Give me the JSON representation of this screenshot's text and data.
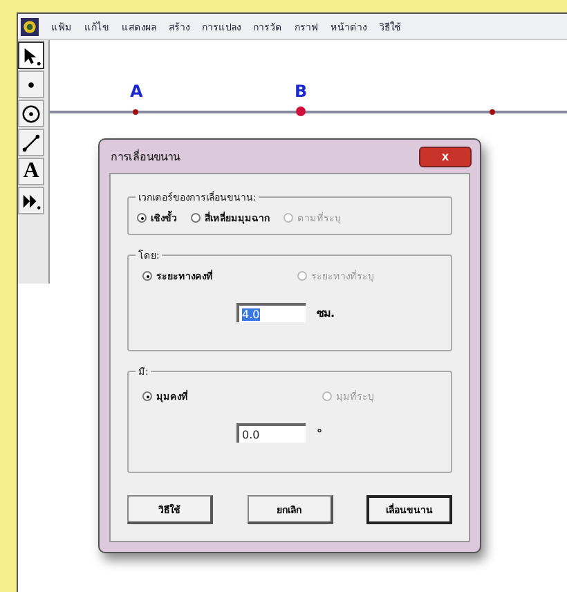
{
  "menu": [
    {
      "label": "แฟ้ม"
    },
    {
      "label": "แก้ไข"
    },
    {
      "label": "แสดงผล"
    },
    {
      "label": "สร้าง"
    },
    {
      "label": "การแปลง"
    },
    {
      "label": "การวัด"
    },
    {
      "label": "กราฟ"
    },
    {
      "label": "หน้าต่าง"
    },
    {
      "label": "วิธีใช้"
    }
  ],
  "tools": [
    {
      "kind": "arrow",
      "selected": true
    },
    {
      "kind": "point",
      "selected": false
    },
    {
      "kind": "compass",
      "selected": false
    },
    {
      "kind": "segment",
      "selected": false
    },
    {
      "kind": "text",
      "glyph": "A",
      "selected": false
    },
    {
      "kind": "custom",
      "selected": false
    }
  ],
  "canvas": {
    "points": [
      {
        "label": "A",
        "large": false
      },
      {
        "label": "B",
        "large": true
      },
      {
        "large": false
      }
    ]
  },
  "dialog": {
    "title": "การเลื่อนขนาน",
    "close": "x",
    "groups": [
      {
        "legend": "เวกเตอร์ของการเลื่อนขนาน:",
        "options": [
          {
            "label": "เชิงขั้ว",
            "selected": true,
            "disabled": false
          },
          {
            "label": "สี่เหลี่ยมมุมฉาก",
            "selected": false,
            "disabled": false
          },
          {
            "label": "ตามที่ระบุ",
            "selected": false,
            "disabled": true
          }
        ]
      },
      {
        "legend": "โดย:",
        "options": [
          {
            "label": "ระยะทางคงที่",
            "selected": true,
            "disabled": false
          },
          {
            "label": "ระยะทางที่ระบุ",
            "selected": false,
            "disabled": true
          }
        ],
        "field": {
          "value": "4.0",
          "highlighted": true,
          "unit": "ซม."
        }
      },
      {
        "legend": "มี:",
        "options": [
          {
            "label": "มุมคงที่",
            "selected": true,
            "disabled": false
          },
          {
            "label": "มุมที่ระบุ",
            "selected": false,
            "disabled": true
          }
        ],
        "field": {
          "value": "0.0",
          "highlighted": false,
          "unit": "°"
        }
      }
    ],
    "buttons": [
      {
        "label": "วิธีใช้",
        "default": false
      },
      {
        "label": "ยกเลิก",
        "default": false
      },
      {
        "label": "เลื่อนขนาน",
        "default": true
      }
    ]
  }
}
